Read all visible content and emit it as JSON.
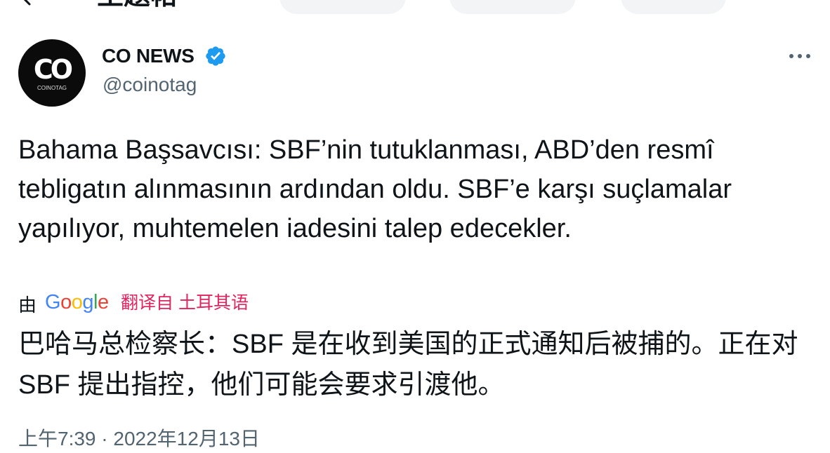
{
  "header": {
    "title": "主题帖"
  },
  "author": {
    "name": "CO NEWS",
    "handle": "@coinotag",
    "avatar_text": "COINOTAG",
    "avatar_logo": "CO",
    "verified_icon": "verified-badge-icon",
    "verified_color": "#1d9bf0"
  },
  "tweet": {
    "text": "Bahama Başsavcısı: SBF’nin tutuklanması, ABD’den resmî tebligatın alınmasının ardından oldu. SBF’e karşı suçlamalar yapılıyor, muhtemelen iadesini talep edecekler.",
    "translation_by": "由",
    "translation_provider": "Google",
    "translation_label": "翻译自 土耳其语",
    "translated_text": "巴哈马总检察长：SBF 是在收到美国的正式通知后被捕的。正在对 SBF 提出指控，他们可能会要求引渡他。",
    "timestamp": "上午7:39 · 2022年12月13日"
  },
  "colors": {
    "text": "#0f1419",
    "secondary": "#536471",
    "translate_link": "#e0245e"
  }
}
